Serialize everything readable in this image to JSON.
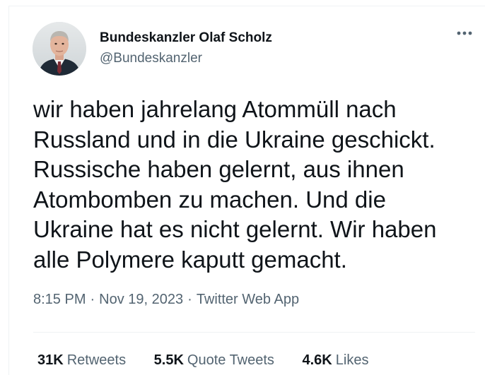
{
  "author": {
    "display_name": "Bundeskanzler Olaf Scholz",
    "handle": "@Bundeskanzler",
    "avatar_icon": "profile-photo"
  },
  "more_icon": "ellipsis-icon",
  "tweet": {
    "text": "wir haben jahrelang Atommüll nach\nRussland und in die Ukraine geschickt.\nRussische haben gelernt, aus ihnen\nAtombomben zu machen. Und die\nUkraine hat es nicht gelernt. Wir haben\nalle Polymere kaputt gemacht.",
    "time": "8:15 PM",
    "separator": "·",
    "date": "Nov 19, 2023",
    "source": "Twitter Web App"
  },
  "stats": {
    "retweets": {
      "count": "31K",
      "label": "Retweets"
    },
    "quote_tweets": {
      "count": "5.5K",
      "label": "Quote Tweets"
    },
    "likes": {
      "count": "4.6K",
      "label": "Likes"
    }
  },
  "colors": {
    "text": "#0f1419",
    "secondary": "#536471",
    "border": "#eff3f4"
  }
}
